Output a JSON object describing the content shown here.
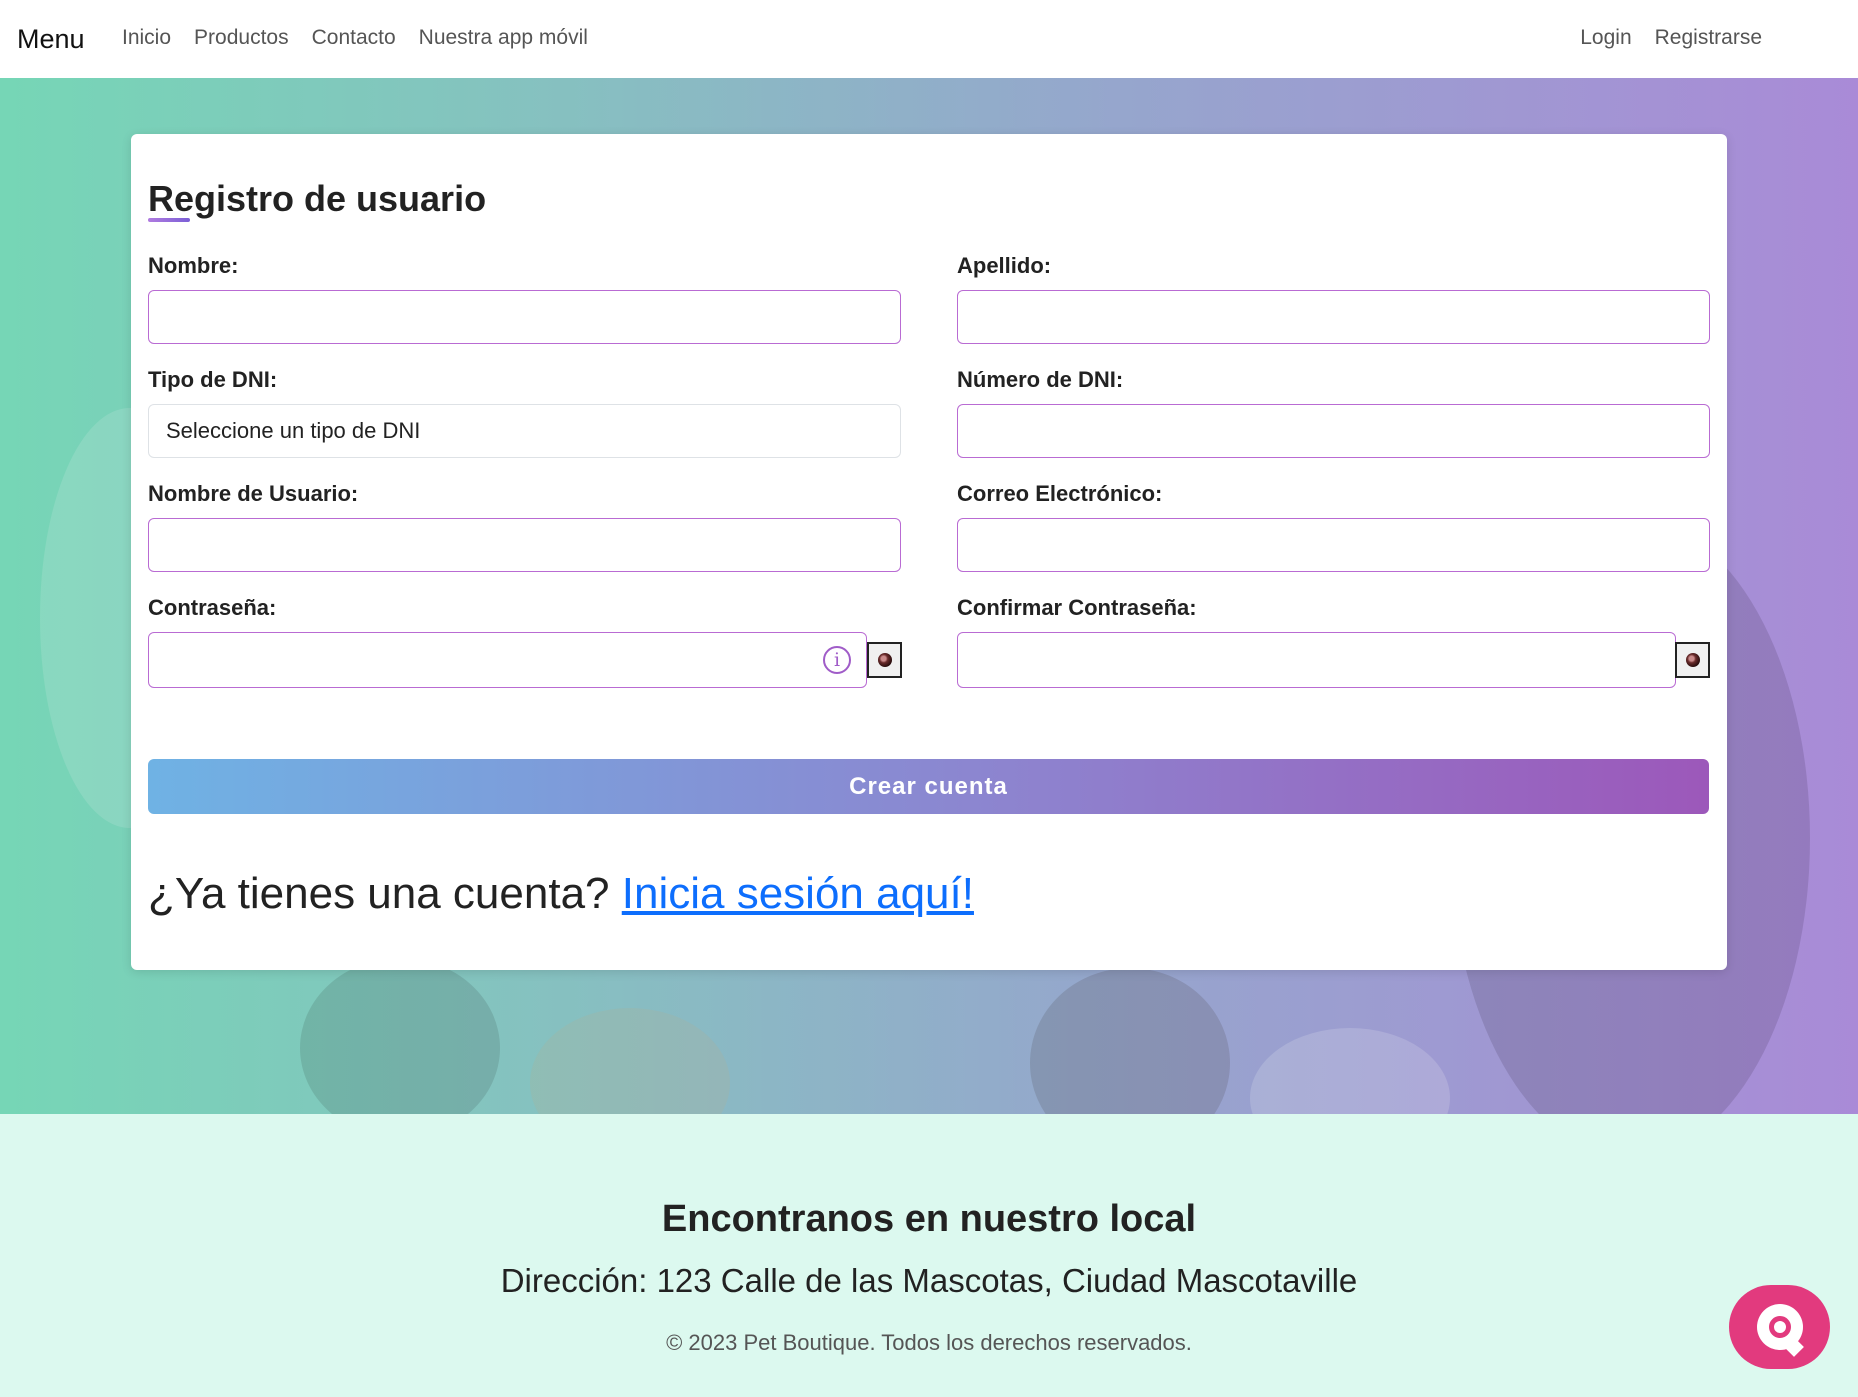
{
  "navbar": {
    "brand": "Menu",
    "links_left": [
      "Inicio",
      "Productos",
      "Contacto",
      "Nuestra app móvil"
    ],
    "links_right": [
      "Login",
      "Registrarse"
    ]
  },
  "form": {
    "title": "Registro de usuario",
    "fields": {
      "nombre": {
        "label": "Nombre:",
        "value": ""
      },
      "apellido": {
        "label": "Apellido:",
        "value": ""
      },
      "tipo_dni": {
        "label": "Tipo de DNI:",
        "selected": "Seleccione un tipo de DNI"
      },
      "numero_dni": {
        "label": "Número de DNI:",
        "value": ""
      },
      "usuario": {
        "label": "Nombre de Usuario:",
        "value": ""
      },
      "correo": {
        "label": "Correo Electrónico:",
        "value": ""
      },
      "contrasena": {
        "label": "Contraseña:",
        "value": ""
      },
      "confirmar": {
        "label": "Confirmar Contraseña:",
        "value": ""
      }
    },
    "info_icon": "i",
    "submit_label": "Crear cuenta",
    "have_account_text": "¿Ya tienes una cuenta?",
    "login_link": "Inicia sesión aquí!"
  },
  "footer": {
    "title": "Encontranos en nuestro local",
    "address": "Dirección: 123 Calle de las Mascotas, Ciudad Mascotaville",
    "copyright": "© 2023 Pet Boutique. Todos los derechos reservados."
  },
  "colors": {
    "accent": "#b96bd3",
    "link": "#0d6efd",
    "chat_button": "#e23a7e",
    "footer_bg": "#dcf9ef"
  },
  "icons": {
    "info": "info-icon",
    "eye": "eye-icon",
    "chat": "chat-icon"
  }
}
